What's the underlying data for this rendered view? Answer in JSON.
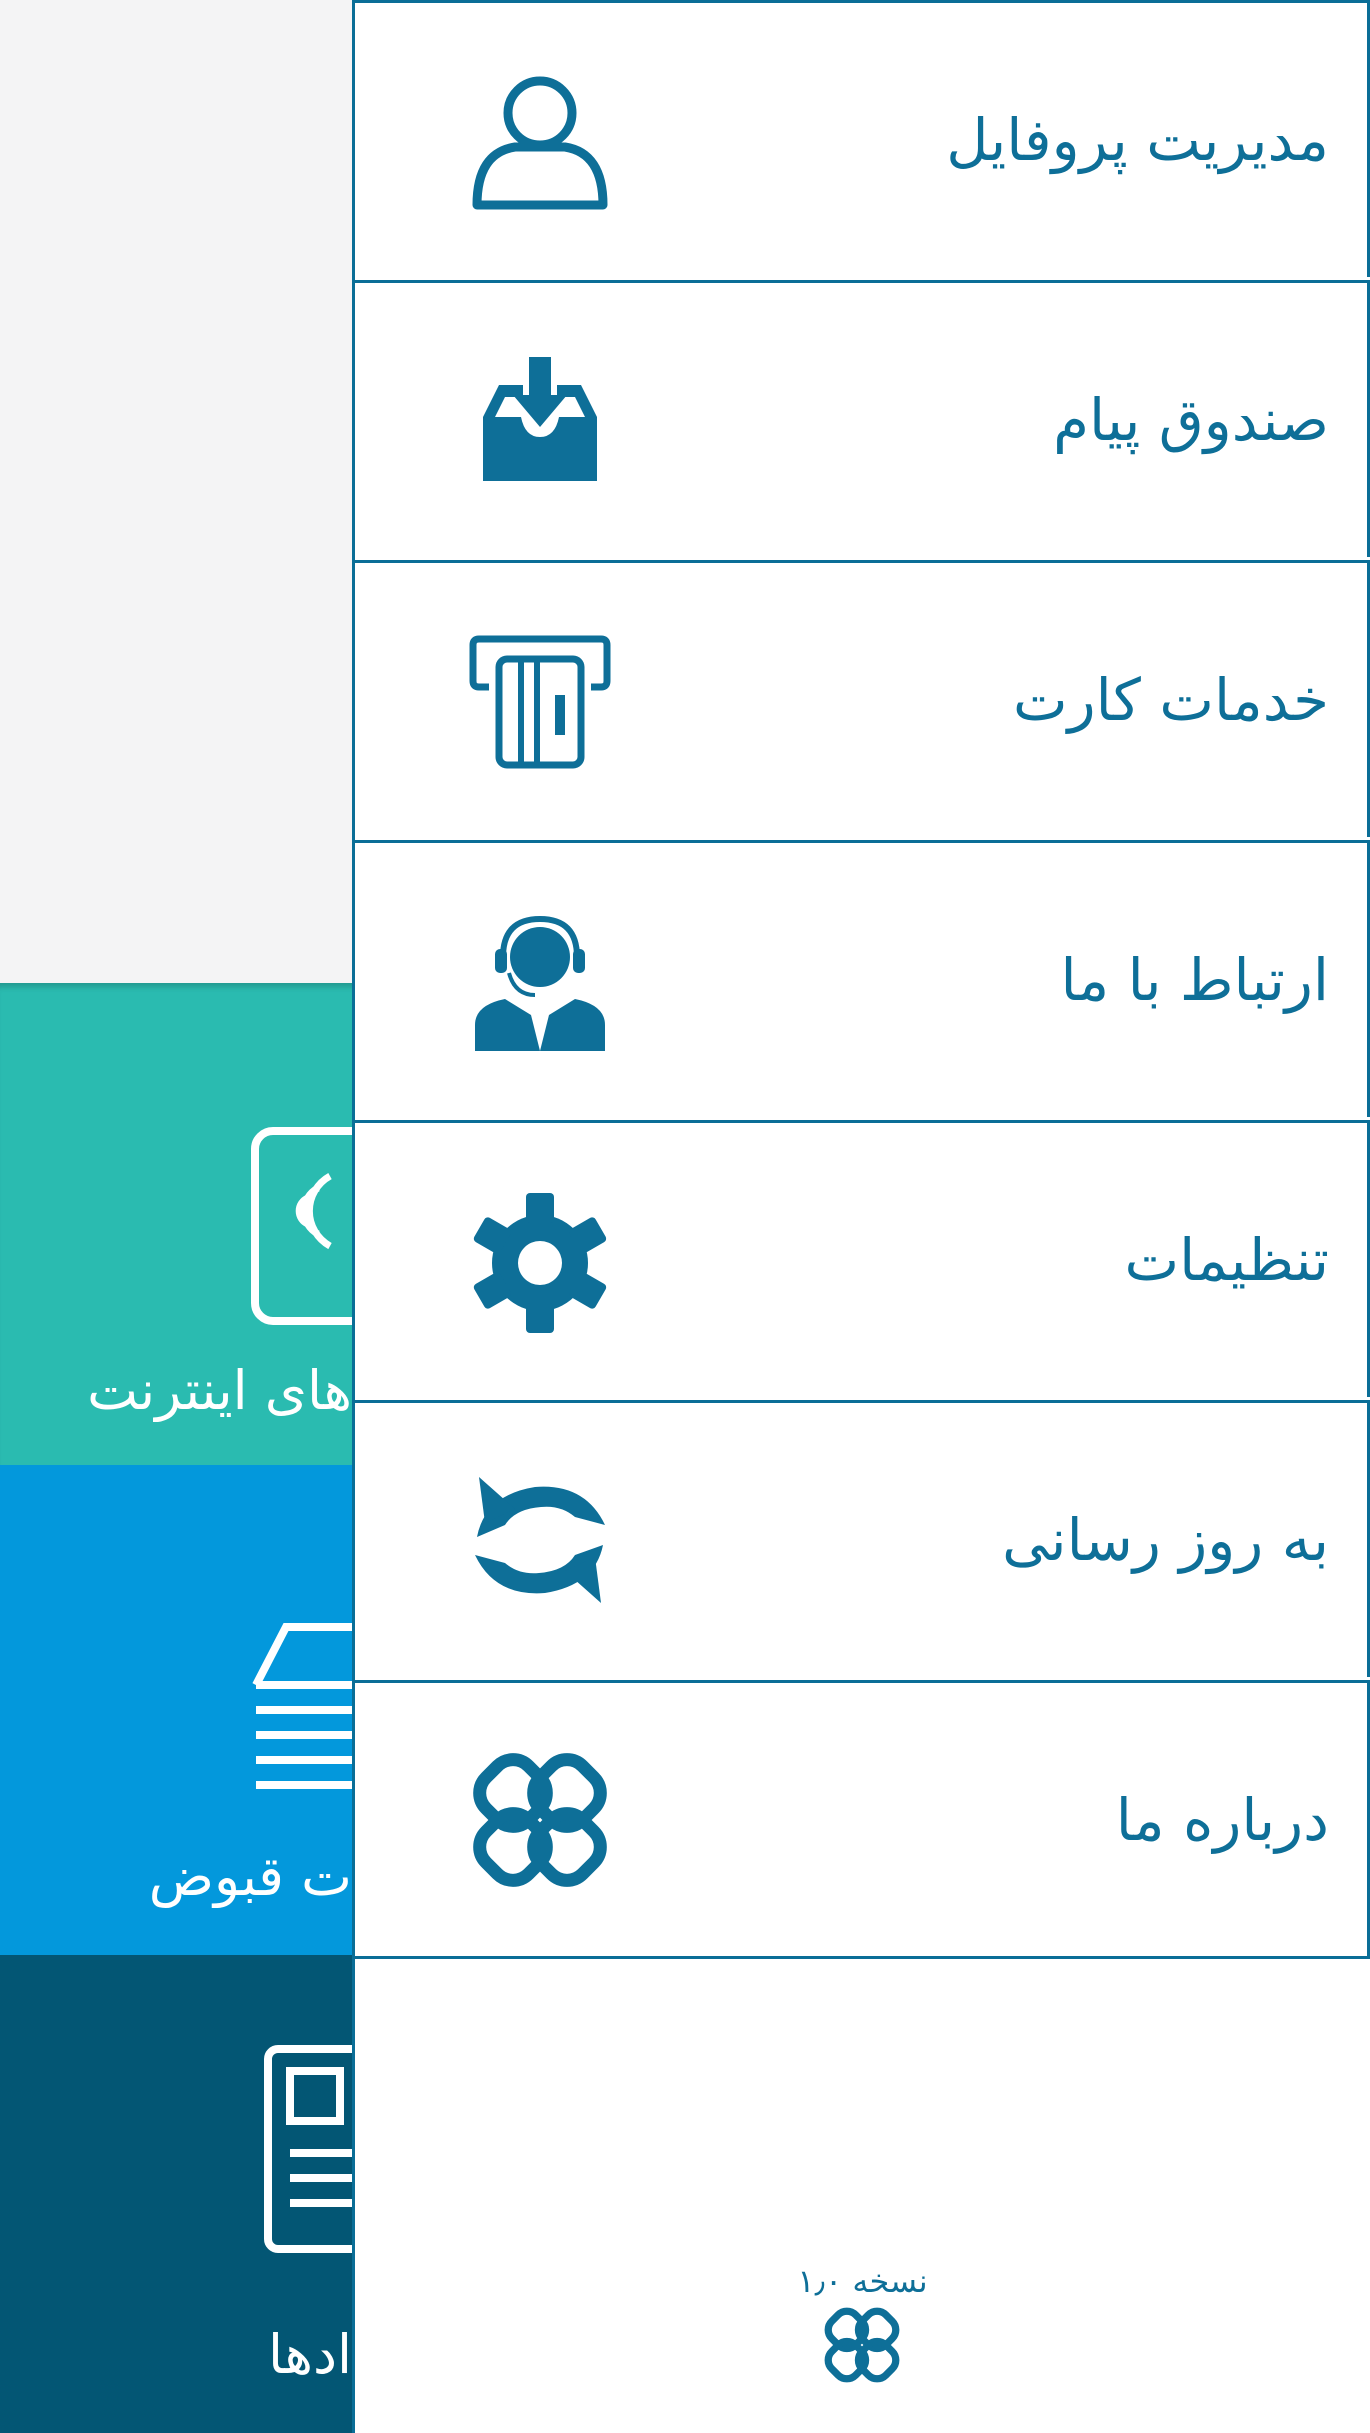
{
  "background": {
    "tiles": [
      {
        "label": "های اینترنت",
        "icon": "contactless-card-icon",
        "color": "#2abbb0"
      },
      {
        "label": "ت قبوض",
        "icon": "bill-receipt-icon",
        "color": "#0398dc"
      },
      {
        "label": "ادها",
        "icon": "document-icon",
        "color": "#035674"
      }
    ]
  },
  "drawer": {
    "items": [
      {
        "label": "مدیریت پروفایل",
        "icon": "user-icon"
      },
      {
        "label": "صندوق پیام",
        "icon": "inbox-download-icon"
      },
      {
        "label": "خدمات کارت",
        "icon": "atm-card-icon"
      },
      {
        "label": "ارتباط با ما",
        "icon": "support-agent-icon"
      },
      {
        "label": "تنظیمات",
        "icon": "gear-icon"
      },
      {
        "label": "به روز رسانی",
        "icon": "refresh-icon"
      },
      {
        "label": "درباره ما",
        "icon": "link-logo-icon"
      }
    ],
    "version": "نسخه ۱٫۰"
  },
  "colors": {
    "accent": "#0e6f98",
    "border": "#0a6e97",
    "tile_internet": "#2abbb0",
    "tile_bills": "#0398dc",
    "tile_contracts": "#035674"
  }
}
